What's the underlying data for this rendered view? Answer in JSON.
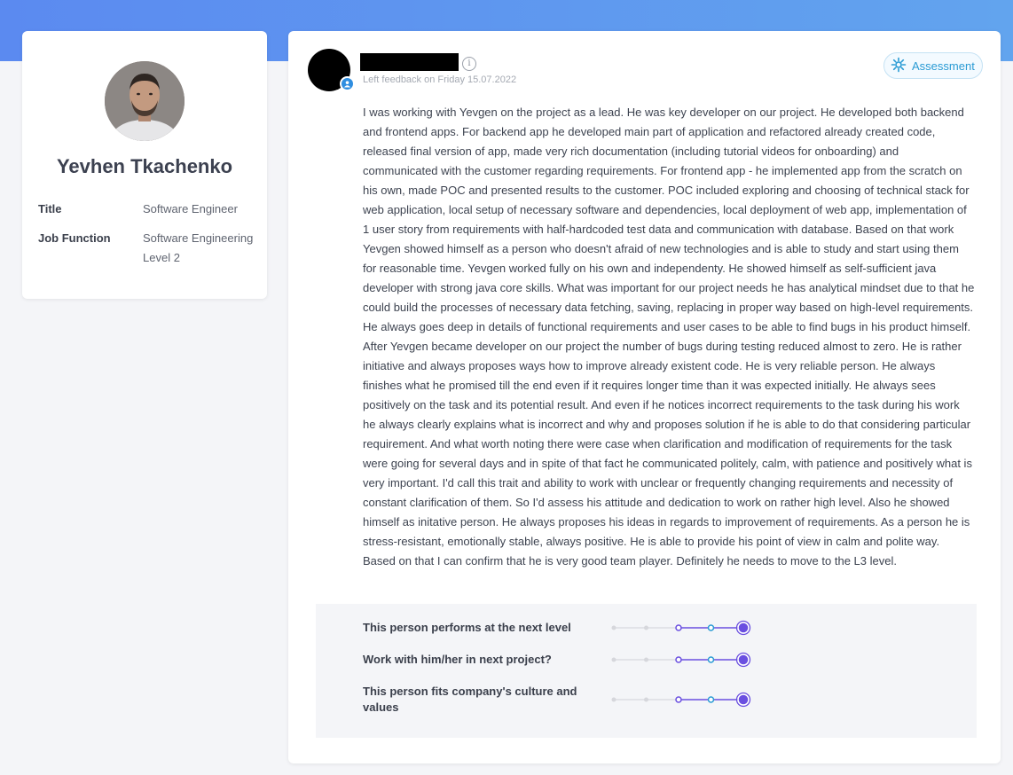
{
  "profile": {
    "name": "Yevhen Tkachenko",
    "fields": [
      {
        "label": "Title",
        "value": "Software Engineer"
      },
      {
        "label": "Job Function",
        "value": "Software Engineering Level 2"
      }
    ]
  },
  "feedback": {
    "date": "Left feedback on Friday 15.07.2022",
    "info_icon": "i",
    "assessment_label": "Assessment",
    "text": "I was working with Yevgen on the project as a lead. He was key developer on our project. He developed both backend and frontend apps. For backend app he developed main part of application and refactored already created code, released final version of app, made very rich documentation (including tutorial videos for onboarding) and communicated with the customer regarding requirements. For frontend app - he implemented app from the scratch on his own, made POC and presented results to the customer. POC included exploring and choosing of technical stack for web application, local setup of necessary software and dependencies, local deployment of web app, implementation of 1 user story from requirements with half-hardcoded test data and communication with database. Based on that work Yevgen showed himself as a person who doesn't afraid of new technologies and is able to study and start using them for reasonable time. Yevgen worked fully on his own and independenty. He showed himself as self-sufficient java developer with strong java core skills. What was important for our project needs he has analytical mindset due to that he could build the processes of necessary data fetching, saving, replacing in proper way based on high-level requirements. He always goes deep in details of functional requirements and user cases to be able to find bugs in his product himself. After Yevgen became developer on our project the number of bugs during testing reduced almost to zero. He is rather initiative and always proposes ways how to improve already existent code. He is very reliable person. He always finishes what he promised till the end even if it requires longer time than it was expected initially. He always sees positively on the task and its potential result. And even if he notices incorrect requirements to the task during his work he always clearly explains what is incorrect and why and proposes solution if he is able to do that considering particular requirement. And what worth noting there were case when clarification and modification of requirements for the task were going for several days and in spite of that fact he communicated politely, calm, with patience and positively what is very important. I'd call this trait and ability to work with unclear or frequently changing requirements and necessity of constant clarification of them. So I'd assess his attitude and dedication to work on rather high level. Also he showed himself as initative person. He always proposes his ideas in regards to improvement of requirements. As a person he is stress-resistant, emotionally stable, always positive. He is able to provide his point of view in calm and polite way. Based on that I can confirm that he is very good team player. Definitely he needs to move to the L3 level.",
    "ratings": [
      {
        "label": "This person performs at the next level",
        "level": 5,
        "max": 5
      },
      {
        "label": "Work with him/her in next project?",
        "level": 5,
        "max": 5
      },
      {
        "label": "This person fits company's culture and values",
        "level": 5,
        "max": 5
      }
    ]
  },
  "colors": {
    "accent_purple": "#6a4fe0",
    "accent_blue": "#2a9bd4",
    "header_gradient_start": "#5b8af0",
    "header_gradient_end": "#62a4ee"
  }
}
